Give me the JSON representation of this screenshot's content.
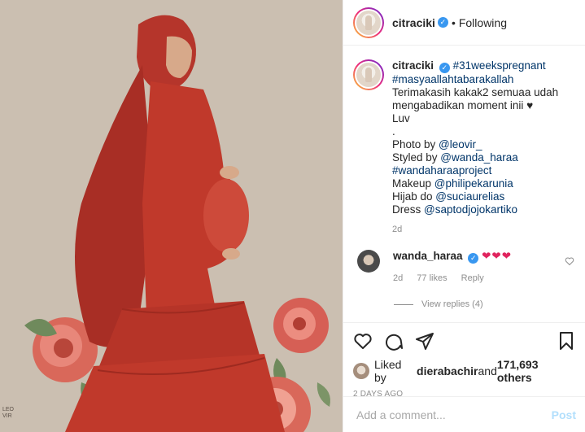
{
  "header": {
    "username": "citraciki",
    "separator": "•",
    "follow_status": "Following"
  },
  "caption": {
    "username": "citraciki",
    "hashtag_main": "#31weekspregnant",
    "hashtag_second": "#masyaallahtabarakallah",
    "line1": "Terimakasih kakak2 semuaa udah",
    "line2": "mengabadikan moment inii ♥",
    "line3": "Luv",
    "line4": ".",
    "photo_prefix": "Photo by ",
    "photo_handle": "@leovir_",
    "styled_prefix": "Styled by ",
    "styled_handle": "@wanda_haraa",
    "project_tag": "#wandaharaaproject",
    "makeup_prefix": "Makeup ",
    "makeup_handle": "@philipekarunia",
    "hijab_prefix": "Hijab do ",
    "hijab_handle": "@suciaurelias",
    "dress_prefix": "Dress ",
    "dress_handle": "@saptodjojokartiko",
    "age": "2d"
  },
  "comment": {
    "username": "wanda_haraa",
    "text": "❤❤❤",
    "age": "2d",
    "likes": "77 likes",
    "reply": "Reply",
    "view_replies": "View replies (4)"
  },
  "likes": {
    "prefix": "Liked by ",
    "user": "dierabachir",
    "middle": " and ",
    "count": "171,693 others"
  },
  "posted_time": "2 DAYS AGO",
  "add_comment": {
    "placeholder": "Add a comment...",
    "post_label": "Post"
  },
  "photo": {
    "watermark": "LEO VIR"
  },
  "colors": {
    "dress": "#c0392b",
    "background": "#cbbfb1",
    "link": "#003569",
    "verified": "#3897f0"
  }
}
